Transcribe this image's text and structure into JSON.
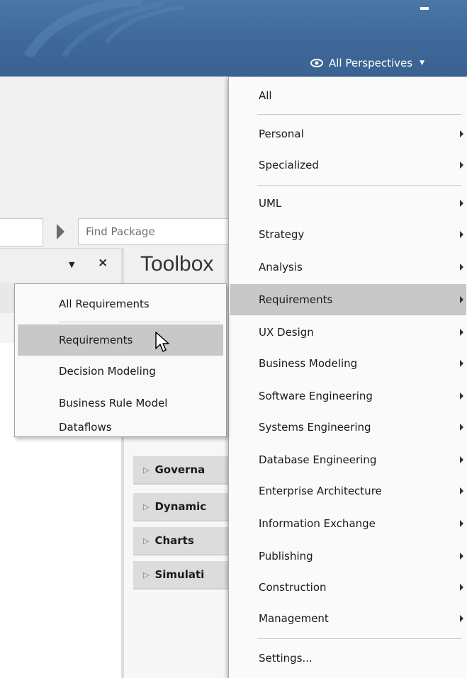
{
  "ribbon": {
    "perspectives_label": "All Perspectives",
    "accent_color": "#3e6899"
  },
  "toolbar": {
    "find_package_placeholder": "Find Package"
  },
  "toolbox": {
    "title": "Toolbox",
    "groups": [
      "Governa",
      "Dynamic",
      "Charts",
      "Simulati"
    ]
  },
  "perspectives_menu": {
    "items": [
      {
        "label": "All",
        "submenu": false
      },
      {
        "label": "Personal",
        "submenu": true
      },
      {
        "label": "Specialized",
        "submenu": true
      },
      {
        "label": "UML",
        "submenu": true
      },
      {
        "label": "Strategy",
        "submenu": true
      },
      {
        "label": "Analysis",
        "submenu": true
      },
      {
        "label": "Requirements",
        "submenu": true,
        "highlighted": true
      },
      {
        "label": "UX Design",
        "submenu": true
      },
      {
        "label": "Business Modeling",
        "submenu": true
      },
      {
        "label": "Software Engineering",
        "submenu": true
      },
      {
        "label": "Systems Engineering",
        "submenu": true
      },
      {
        "label": "Database Engineering",
        "submenu": true
      },
      {
        "label": "Enterprise Architecture",
        "submenu": true
      },
      {
        "label": "Information Exchange",
        "submenu": true
      },
      {
        "label": "Publishing",
        "submenu": true
      },
      {
        "label": "Construction",
        "submenu": true
      },
      {
        "label": "Management",
        "submenu": true
      },
      {
        "label": "Settings...",
        "submenu": false
      }
    ]
  },
  "requirements_submenu": {
    "items": [
      {
        "label": "All Requirements"
      },
      {
        "label": "Requirements",
        "highlighted": true
      },
      {
        "label": "Decision Modeling"
      },
      {
        "label": "Business Rule Model"
      },
      {
        "label": "Dataflows"
      }
    ]
  }
}
